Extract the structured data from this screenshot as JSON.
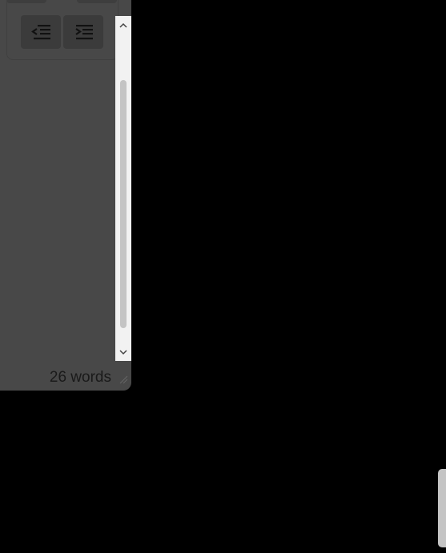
{
  "editor": {
    "toolbar": {
      "outdent_icon": "outdent-icon",
      "indent_icon": "indent-icon"
    },
    "status": {
      "word_count": "26 words"
    },
    "scrollbar": {
      "up_icon": "chevron-up-icon",
      "down_icon": "chevron-down-icon"
    }
  },
  "colors": {
    "panel_bg": "#484848",
    "page_bg": "#000000",
    "scrollbar_track": "#f2f2f2",
    "scrollbar_thumb": "#c4c4c4"
  }
}
